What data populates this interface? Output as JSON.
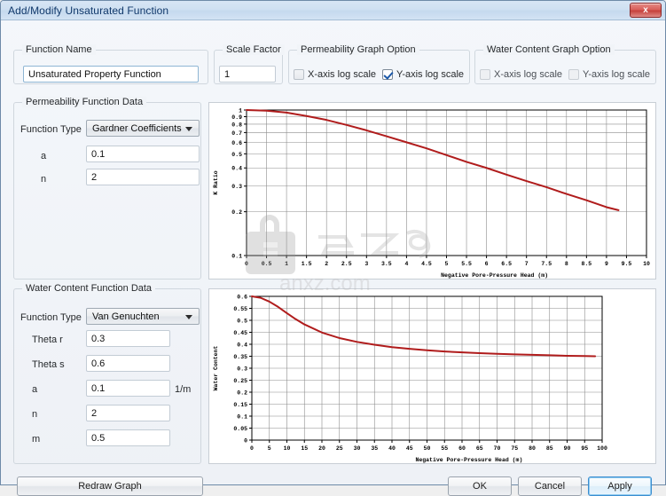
{
  "window": {
    "title": "Add/Modify Unsaturated Function",
    "close_label": "x"
  },
  "form": {
    "function_name": {
      "legend": "Function Name",
      "value": "Unsaturated Property Function"
    },
    "scale_factor": {
      "legend": "Scale Factor",
      "value": "1"
    },
    "permeability_graph_option": {
      "legend": "Permeability Graph Option",
      "x_log": {
        "label": "X-axis log scale",
        "checked": false
      },
      "y_log": {
        "label": "Y-axis log scale",
        "checked": true
      }
    },
    "water_content_graph_option": {
      "legend": "Water Content Graph Option",
      "x_log": {
        "label": "X-axis log scale",
        "checked": false
      },
      "y_log": {
        "label": "Y-axis log scale",
        "checked": false
      }
    },
    "permeability_function_data": {
      "legend": "Permeability Function Data",
      "function_type_label": "Function Type",
      "function_type_value": "Gardner Coefficients",
      "fields": [
        {
          "label": "a",
          "value": "0.1",
          "unit": ""
        },
        {
          "label": "n",
          "value": "2",
          "unit": ""
        }
      ]
    },
    "water_content_function_data": {
      "legend": "Water Content Function Data",
      "function_type_label": "Function Type",
      "function_type_value": "Van Genuchten",
      "fields": [
        {
          "label": "Theta r",
          "value": "0.3",
          "unit": ""
        },
        {
          "label": "Theta s",
          "value": "0.6",
          "unit": ""
        },
        {
          "label": "a",
          "value": "0.1",
          "unit": "1/m"
        },
        {
          "label": "n",
          "value": "2",
          "unit": ""
        },
        {
          "label": "m",
          "value": "0.5",
          "unit": ""
        }
      ]
    }
  },
  "buttons": {
    "redraw": "Redraw Graph",
    "ok": "OK",
    "cancel": "Cancel",
    "apply": "Apply"
  },
  "watermark": {
    "text": "anxz.com"
  },
  "colors": {
    "curve": "#b01c1c",
    "title_text": "#11396b",
    "accent_focus": "#3b8ed0",
    "close_red": "#c6413c"
  },
  "chart_data": [
    {
      "type": "line",
      "title": "",
      "xlabel": "Negative Pore-Pressure Head (m)",
      "ylabel": "K Ratio",
      "xlim": [
        0,
        10
      ],
      "ylim": [
        0.1,
        1
      ],
      "yscale": "log",
      "xscale": "linear",
      "grid": true,
      "xticks": [
        0,
        0.5,
        1,
        1.5,
        2,
        2.5,
        3,
        3.5,
        4,
        4.5,
        5,
        5.5,
        6,
        6.5,
        7,
        7.5,
        8,
        8.5,
        9,
        9.5,
        10
      ],
      "xticklabels": [
        "0",
        "0.5",
        "1",
        "1.5",
        "2",
        "2.5",
        "3",
        "3.5",
        "4",
        "4.5",
        "5",
        "5.5",
        "6",
        "6.5",
        "7",
        "7.5",
        "8",
        "8.5",
        "9",
        "9.5",
        "10"
      ],
      "yticks": [
        0.1,
        0.2,
        0.3,
        0.4,
        0.5,
        0.6,
        0.7,
        0.8,
        0.9,
        1
      ],
      "yticklabels": [
        "0.1",
        "0.2",
        "0.3",
        "0.4",
        "0.5",
        "0.6",
        "0.7",
        "0.8",
        "0.9",
        "1"
      ],
      "series": [
        {
          "name": "K Ratio",
          "color": "#b01c1c",
          "x": [
            0,
            0.5,
            1,
            1.5,
            2,
            2.5,
            3,
            3.5,
            4,
            4.5,
            5,
            5.5,
            6,
            6.5,
            7,
            7.5,
            8,
            8.5,
            9,
            9.3
          ],
          "y": [
            1.0,
            0.99,
            0.96,
            0.91,
            0.855,
            0.79,
            0.725,
            0.66,
            0.6,
            0.545,
            0.49,
            0.44,
            0.4,
            0.36,
            0.325,
            0.295,
            0.265,
            0.24,
            0.215,
            0.205
          ]
        }
      ]
    },
    {
      "type": "line",
      "title": "",
      "xlabel": "Negative Pore-Pressure Head (m)",
      "ylabel": "Water Content",
      "xlim": [
        0,
        100
      ],
      "ylim": [
        0,
        0.6
      ],
      "yscale": "linear",
      "xscale": "linear",
      "grid": true,
      "xticks": [
        0,
        5,
        10,
        15,
        20,
        25,
        30,
        35,
        40,
        45,
        50,
        55,
        60,
        65,
        70,
        75,
        80,
        85,
        90,
        95,
        100
      ],
      "xticklabels": [
        "0",
        "5",
        "10",
        "15",
        "20",
        "25",
        "30",
        "35",
        "40",
        "45",
        "50",
        "55",
        "60",
        "65",
        "70",
        "75",
        "80",
        "85",
        "90",
        "95",
        "100"
      ],
      "yticks": [
        0,
        0.05,
        0.1,
        0.15,
        0.2,
        0.25,
        0.3,
        0.35,
        0.4,
        0.45,
        0.5,
        0.55,
        0.6
      ],
      "yticklabels": [
        "0",
        "0.05",
        "0.1",
        "0.15",
        "0.2",
        "0.25",
        "0.3",
        "0.35",
        "0.4",
        "0.45",
        "0.5",
        "0.55",
        "0.6"
      ],
      "series": [
        {
          "name": "Water Content",
          "color": "#b01c1c",
          "x": [
            0,
            2.5,
            5,
            7.5,
            10,
            12.5,
            15,
            20,
            25,
            30,
            35,
            40,
            45,
            50,
            55,
            60,
            65,
            70,
            75,
            80,
            85,
            90,
            95,
            98
          ],
          "y": [
            0.6,
            0.594,
            0.578,
            0.556,
            0.53,
            0.505,
            0.483,
            0.449,
            0.426,
            0.41,
            0.398,
            0.388,
            0.381,
            0.375,
            0.37,
            0.366,
            0.363,
            0.36,
            0.358,
            0.356,
            0.354,
            0.352,
            0.351,
            0.35
          ]
        }
      ]
    }
  ]
}
